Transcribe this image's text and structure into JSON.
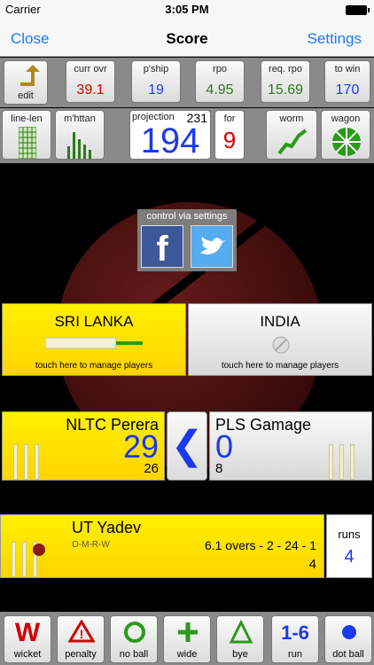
{
  "status": {
    "carrier": "Carrier",
    "time": "3:05 PM"
  },
  "nav": {
    "close": "Close",
    "title": "Score",
    "settings": "Settings"
  },
  "top_row": {
    "edit": "edit",
    "curr_ovr_label": "curr ovr",
    "curr_ovr_value": "39.1",
    "pship_label": "p'ship",
    "pship_value": "19",
    "rpo_label": "rpo",
    "rpo_value": "4.95",
    "req_rpo_label": "req. rpo",
    "req_rpo_value": "15.69",
    "to_win_label": "to win",
    "to_win_value": "170"
  },
  "second_row": {
    "line_len": "line-len",
    "manhattan": "m'httan",
    "projection_label": "projection",
    "projection_small": "231",
    "projection_value": "194",
    "for_label": "for",
    "for_value": "9",
    "worm": "worm",
    "wagon": "wagon"
  },
  "social": {
    "label": "control via settings"
  },
  "teams": {
    "team1": "SRI LANKA",
    "team2": "INDIA",
    "hint": "touch here to manage players"
  },
  "batsmen": {
    "striker_name": "NLTC Perera",
    "striker_runs": "29",
    "striker_balls": "26",
    "non_striker_name": "PLS Gamage",
    "non_striker_runs": "0",
    "non_striker_balls": "8"
  },
  "bowler": {
    "name": "UT Yadev",
    "omrw": "O-M-R-W",
    "figures": "6.1 overs - 2 - 24 - 1",
    "over_runs": "4",
    "runs_label": "runs",
    "runs_value": "4"
  },
  "buttons": [
    {
      "sym": "W",
      "label": "wicket"
    },
    {
      "sym": "!",
      "label": "penalty"
    },
    {
      "sym": "O",
      "label": "no ball"
    },
    {
      "sym": "+",
      "label": "wide"
    },
    {
      "sym": "Δ",
      "label": "bye"
    },
    {
      "sym": "1-6",
      "label": "run"
    },
    {
      "sym": "●",
      "label": "dot ball"
    }
  ],
  "colors": {
    "accent": "#1a7cf5",
    "yellow": "#ffe800",
    "red": "#d40000",
    "green": "#2a7a1a",
    "blue": "#1a39f0"
  }
}
